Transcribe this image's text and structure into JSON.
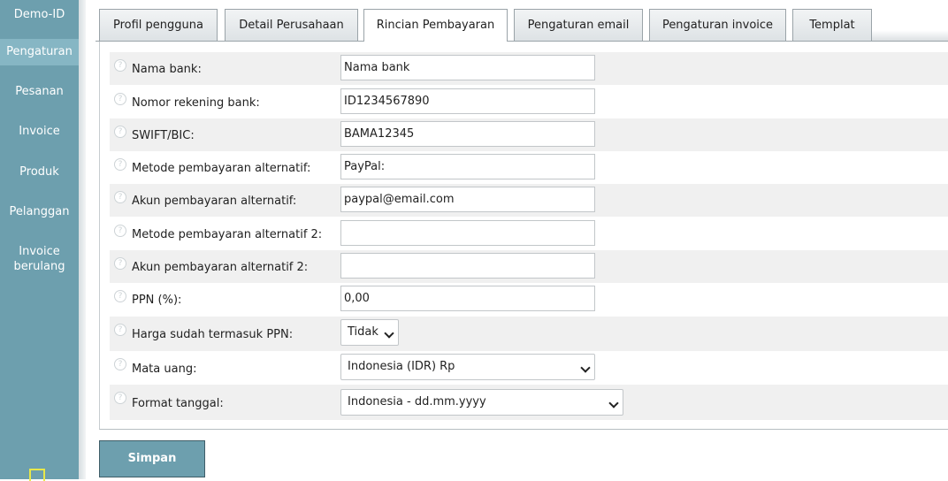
{
  "sidebar": {
    "brand": "Demo-ID",
    "items": [
      {
        "label": "Pengaturan",
        "active": true
      },
      {
        "label": "Pesanan"
      },
      {
        "label": "Invoice"
      },
      {
        "label": "Produk"
      },
      {
        "label": "Pelanggan"
      },
      {
        "label": "Invoice berulang"
      }
    ]
  },
  "tabs": [
    {
      "label": "Profil pengguna"
    },
    {
      "label": "Detail Perusahaan"
    },
    {
      "label": "Rincian Pembayaran",
      "active": true
    },
    {
      "label": "Pengaturan email"
    },
    {
      "label": "Pengaturan invoice"
    },
    {
      "label": "Templat"
    }
  ],
  "form": {
    "fields": [
      {
        "label": "Nama bank:",
        "value": "Nama bank"
      },
      {
        "label": "Nomor rekening bank:",
        "value": "ID1234567890"
      },
      {
        "label": "SWIFT/BIC:",
        "value": "BAMA12345"
      },
      {
        "label": "Metode pembayaran alternatif:",
        "value": "PayPal:"
      },
      {
        "label": "Akun pembayaran alternatif:",
        "value": "paypal@email.com"
      },
      {
        "label": "Metode pembayaran alternatif 2:",
        "value": ""
      },
      {
        "label": "Akun pembayaran alternatif 2:",
        "value": ""
      },
      {
        "label": "PPN (%):",
        "value": "0,00"
      },
      {
        "label": "Harga sudah termasuk PPN:",
        "value": "Tidak"
      },
      {
        "label": "Mata uang:",
        "value": "Indonesia (IDR) Rp"
      },
      {
        "label": "Format tanggal:",
        "value": "Indonesia - dd.mm.yyyy"
      }
    ],
    "help_glyph": "?"
  },
  "save_label": "Simpan",
  "colors": {
    "sidebar": "#6d9fae",
    "sidebar_active": "#86b6c4",
    "save_button": "#6d9fae",
    "row_shade": "#f0f0f0"
  }
}
